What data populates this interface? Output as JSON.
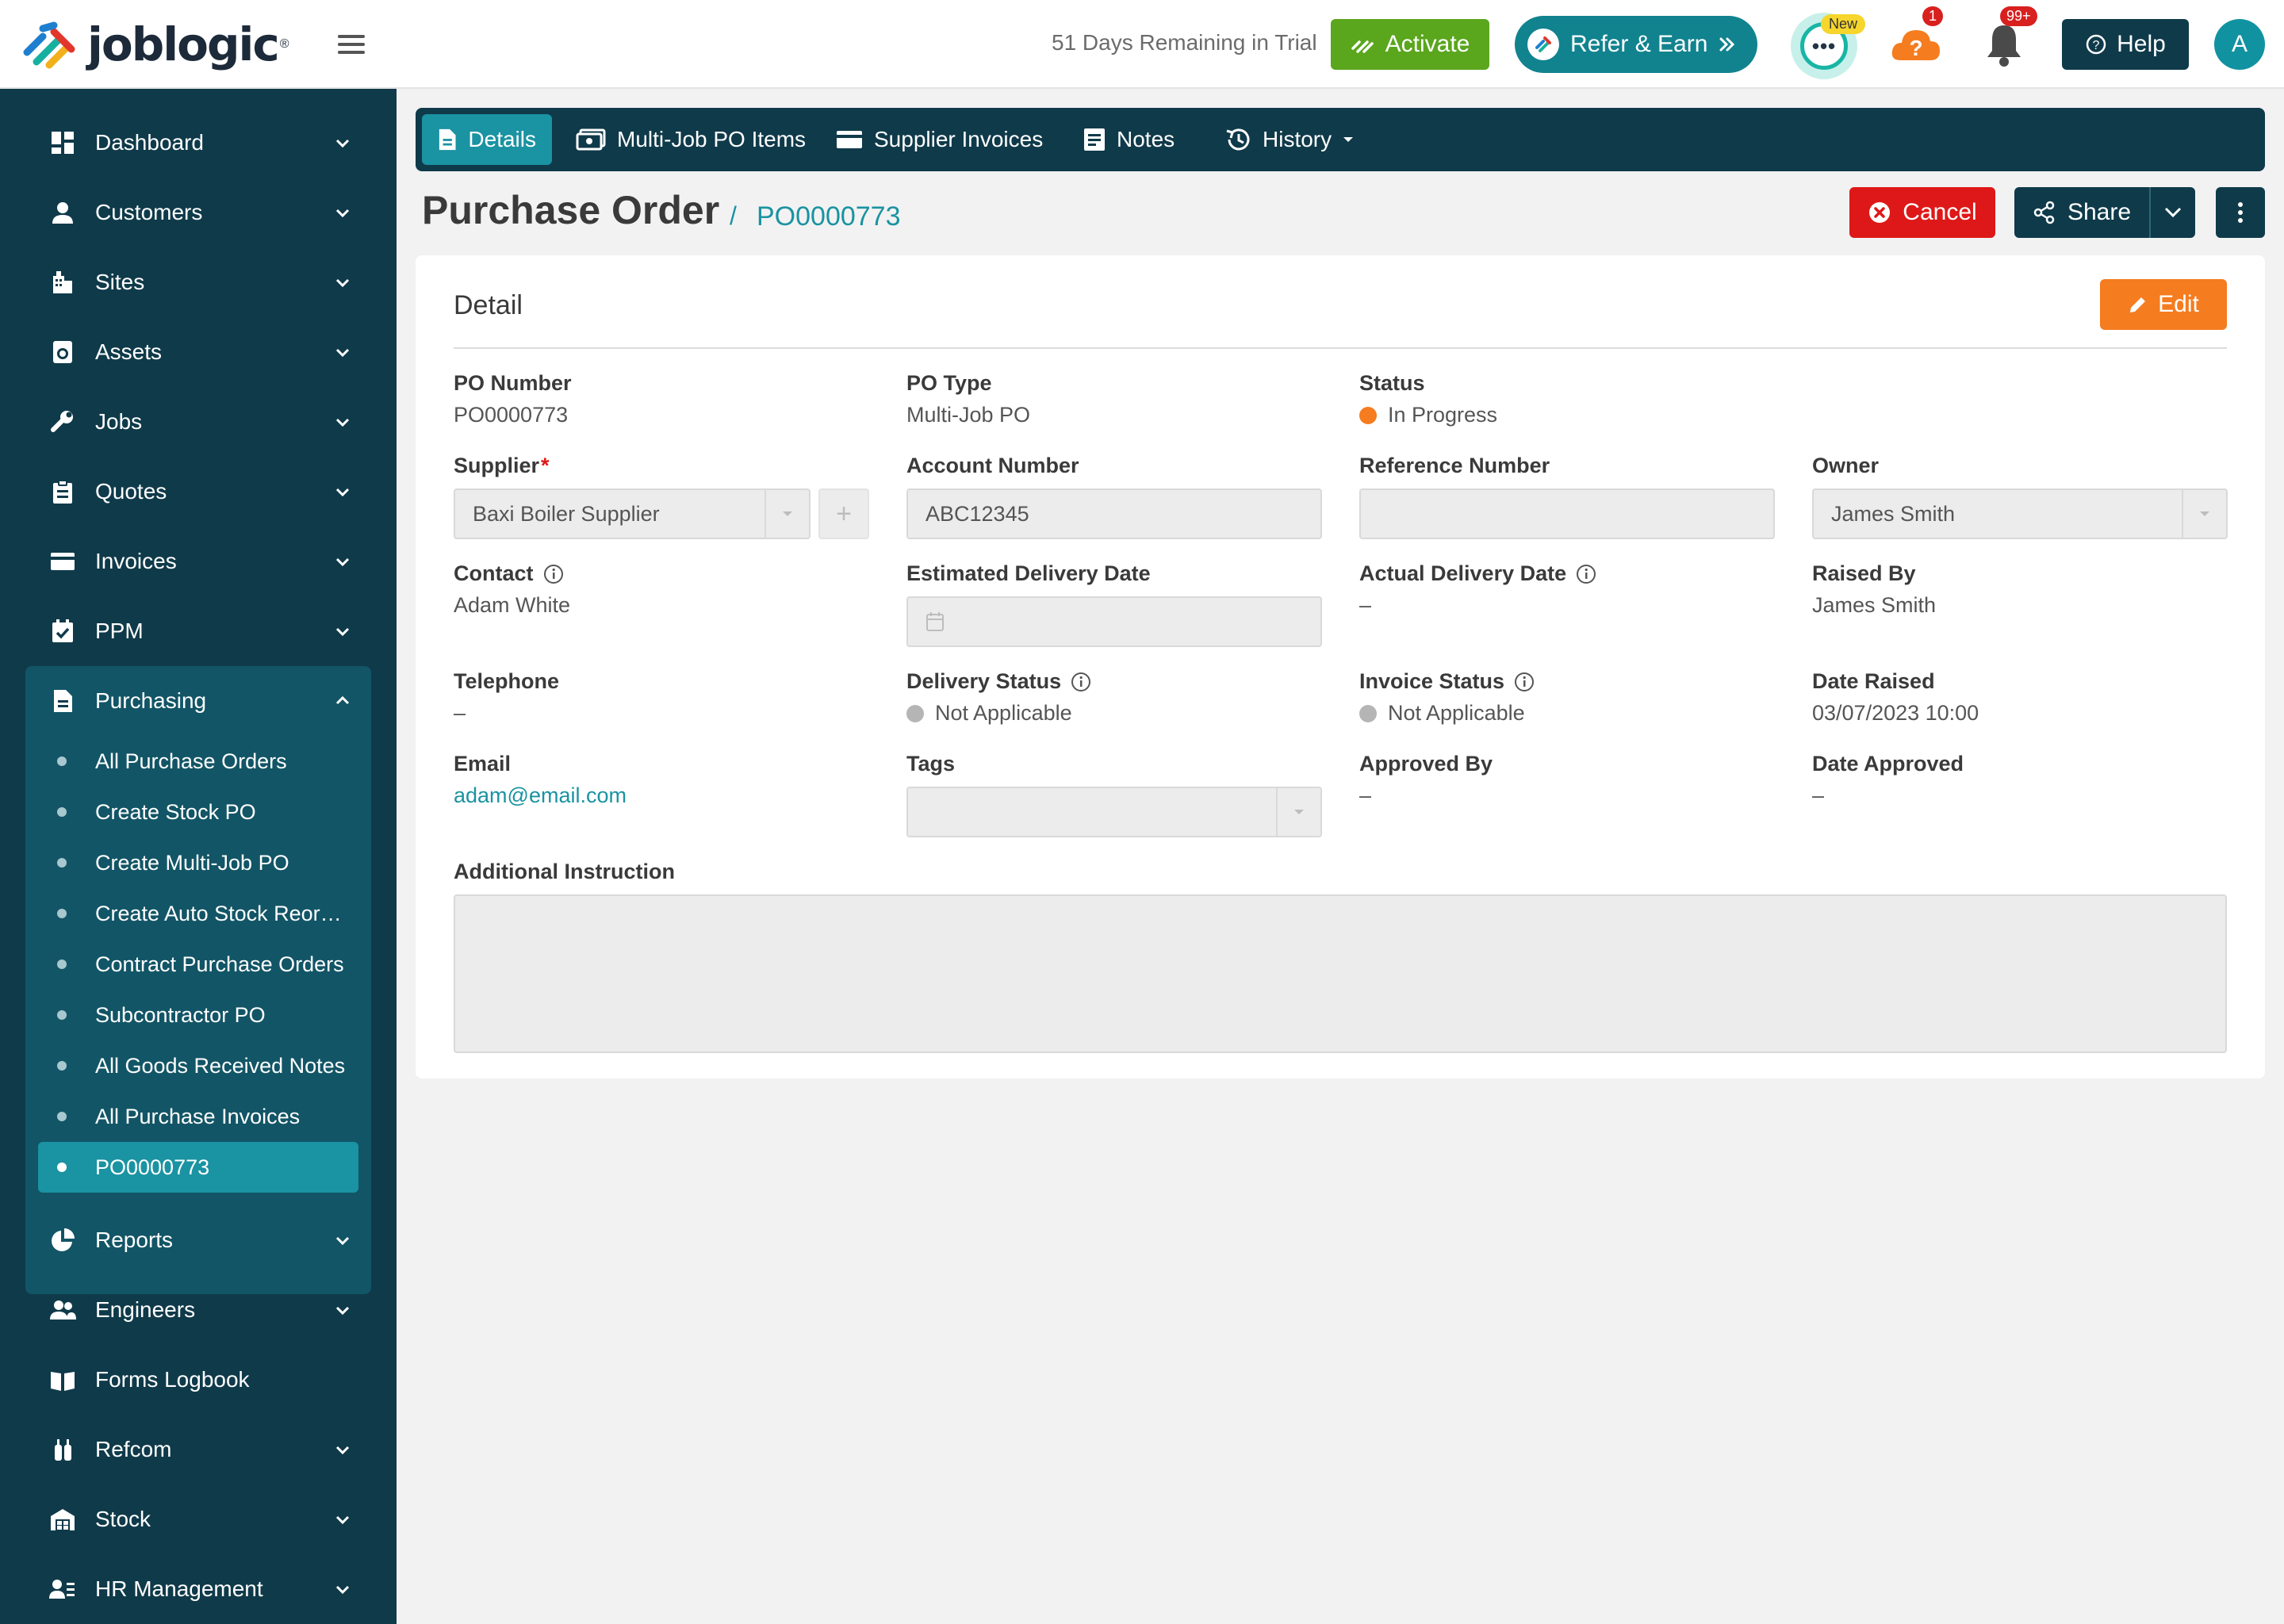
{
  "header": {
    "logo_text": "joblogic",
    "trial_text": "51 Days Remaining in Trial",
    "activate_label": "Activate",
    "refer_label": "Refer & Earn",
    "chat_new_badge": "New",
    "help_badge": "1",
    "notification_badge": "99+",
    "help_label": "Help",
    "avatar_initial": "A"
  },
  "sidebar": {
    "items": [
      {
        "label": "Dashboard",
        "icon": "dashboard-icon"
      },
      {
        "label": "Customers",
        "icon": "user-icon"
      },
      {
        "label": "Sites",
        "icon": "building-icon"
      },
      {
        "label": "Assets",
        "icon": "washer-icon"
      },
      {
        "label": "Jobs",
        "icon": "wrench-icon"
      },
      {
        "label": "Quotes",
        "icon": "clipboard-icon"
      },
      {
        "label": "Invoices",
        "icon": "card-icon"
      },
      {
        "label": "PPM",
        "icon": "calendar-check-icon"
      },
      {
        "label": "Purchasing",
        "icon": "document-icon"
      },
      {
        "label": "Reports",
        "icon": "pie-chart-icon"
      },
      {
        "label": "Engineers",
        "icon": "people-icon"
      },
      {
        "label": "Forms Logbook",
        "icon": "book-icon"
      },
      {
        "label": "Refcom",
        "icon": "gas-cylinder-icon"
      },
      {
        "label": "Stock",
        "icon": "warehouse-icon"
      },
      {
        "label": "HR Management",
        "icon": "user-list-icon"
      }
    ],
    "purchasing_sub": [
      "All Purchase Orders",
      "Create Stock PO",
      "Create Multi-Job PO",
      "Create Auto Stock Reord...",
      "Contract Purchase Orders",
      "Subcontractor PO",
      "All Goods Received Notes",
      "All Purchase Invoices",
      "PO0000773"
    ]
  },
  "tabs": {
    "details": "Details",
    "multi_job_items": "Multi-Job PO Items",
    "supplier_invoices": "Supplier Invoices",
    "notes": "Notes",
    "history": "History"
  },
  "page": {
    "title": "Purchase Order",
    "separator": "/",
    "po_number": "PO0000773",
    "cancel_label": "Cancel",
    "share_label": "Share"
  },
  "detail": {
    "section_title": "Detail",
    "edit_label": "Edit",
    "po_number_label": "PO Number",
    "po_number_value": "PO0000773",
    "po_type_label": "PO Type",
    "po_type_value": "Multi-Job PO",
    "status_label": "Status",
    "status_value": "In Progress",
    "supplier_label": "Supplier",
    "supplier_required": "*",
    "supplier_value": "Baxi Boiler Supplier",
    "account_number_label": "Account Number",
    "account_number_value": "ABC12345",
    "reference_number_label": "Reference Number",
    "reference_number_value": "",
    "owner_label": "Owner",
    "owner_value": "James Smith",
    "contact_label": "Contact",
    "contact_value": "Adam White",
    "est_delivery_label": "Estimated Delivery Date",
    "actual_delivery_label": "Actual Delivery Date",
    "actual_delivery_value": "–",
    "raised_by_label": "Raised By",
    "raised_by_value": "James Smith",
    "telephone_label": "Telephone",
    "telephone_value": "–",
    "delivery_status_label": "Delivery Status",
    "delivery_status_value": "Not Applicable",
    "invoice_status_label": "Invoice Status",
    "invoice_status_value": "Not Applicable",
    "date_raised_label": "Date Raised",
    "date_raised_value": "03/07/2023 10:00",
    "email_label": "Email",
    "email_value": "adam@email.com",
    "tags_label": "Tags",
    "approved_by_label": "Approved By",
    "approved_by_value": "–",
    "date_approved_label": "Date Approved",
    "date_approved_value": "–",
    "additional_instruction_label": "Additional Instruction"
  },
  "colors": {
    "sidebar": "#0f3a4a",
    "accent": "#1a93a2",
    "activate": "#5aa61d",
    "cancel": "#de1818",
    "edit": "#f57c1f",
    "status_in_progress": "#f57c1f",
    "status_not_applicable": "#b5b5b5"
  }
}
